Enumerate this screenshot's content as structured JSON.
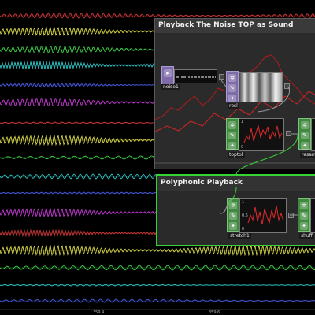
{
  "panels": {
    "noise_sound": {
      "title": "Playback The Noise TOP as Sound"
    },
    "polyphonic": {
      "title": "Polyphonic Playback"
    }
  },
  "nodes": {
    "noise1": {
      "label": "noise1"
    },
    "resl": {
      "label": "resl"
    },
    "toptol": {
      "label": "toptol",
      "axis_top": "1",
      "axis_bottom": "0"
    },
    "resamp": {
      "label": "resamp"
    },
    "stretch1": {
      "label": "stretch1",
      "axis_top": "1",
      "axis_mid": "0.5",
      "axis_bottom": "0"
    },
    "shuff": {
      "label": "shuff"
    }
  },
  "timeline": {
    "tick_a": "359.4",
    "tick_b": "359.6"
  },
  "colors": {
    "accent_green": "#36d236",
    "trace_red": "#cc2222"
  }
}
